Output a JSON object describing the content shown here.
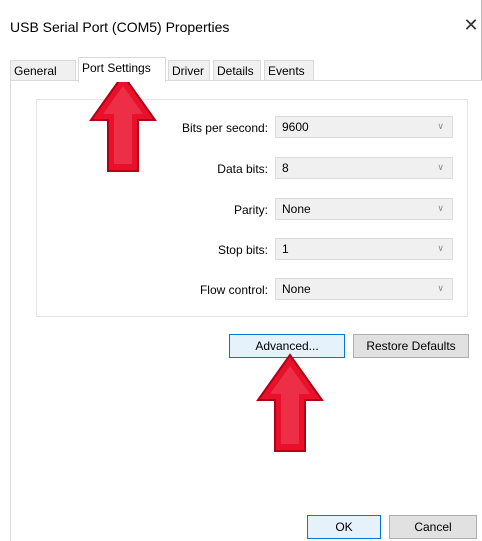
{
  "window": {
    "title": "USB Serial Port (COM5) Properties",
    "close_glyph": "✕"
  },
  "tabs": [
    {
      "label": "General",
      "active": false
    },
    {
      "label": "Port Settings",
      "active": true
    },
    {
      "label": "Driver",
      "active": false
    },
    {
      "label": "Details",
      "active": false
    },
    {
      "label": "Events",
      "active": false
    }
  ],
  "settings": [
    {
      "label": "Bits per second:",
      "value": "9600"
    },
    {
      "label": "Data bits:",
      "value": "8"
    },
    {
      "label": "Parity:",
      "value": "None"
    },
    {
      "label": "Stop bits:",
      "value": "1"
    },
    {
      "label": "Flow control:",
      "value": "None"
    }
  ],
  "buttons": {
    "advanced": "Advanced...",
    "restore_defaults": "Restore Defaults",
    "ok": "OK",
    "cancel": "Cancel"
  },
  "annotation": {
    "arrow_color": "#e8102b",
    "focus_color": "#0078d7"
  }
}
